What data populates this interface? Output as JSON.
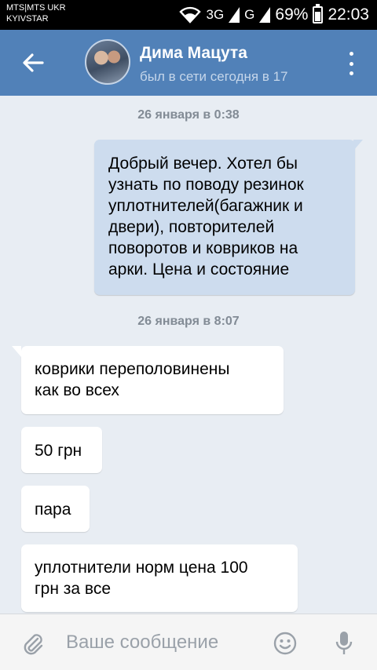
{
  "status_bar": {
    "carrier_line1": "MTS|MTS UKR",
    "carrier_line2": "KYIVSTAR",
    "network1": "3G",
    "network2": "G",
    "battery": "69%",
    "time": "22:03"
  },
  "header": {
    "name": "Дима Мацута",
    "status": "был в сети сегодня в 17"
  },
  "messages": [
    {
      "type": "date",
      "text": "26 января в 0:38"
    },
    {
      "type": "outgoing",
      "lines": [
        "Добрый вечер. Хотел бы",
        "узнать по поводу резинок",
        "уплотнителей(багажник и",
        "двери), повторителей",
        "поворотов и ковриков на",
        "арки. Цена и состояние"
      ]
    },
    {
      "type": "date",
      "text": "26 января в 8:07"
    },
    {
      "type": "incoming",
      "lines": [
        "коврики переполовинены",
        "как во всех"
      ]
    },
    {
      "type": "incoming",
      "lines": [
        "50 грн"
      ]
    },
    {
      "type": "incoming",
      "lines": [
        "пара"
      ]
    },
    {
      "type": "incoming",
      "lines": [
        "уплотнители норм цена 100",
        "грн за все"
      ]
    }
  ],
  "composer": {
    "placeholder": "Ваше сообщение"
  },
  "icons": {
    "back": "arrow-left-icon",
    "menu": "more-vertical-icon",
    "attach": "paperclip-icon",
    "emoji": "smiley-icon",
    "mic": "microphone-icon"
  },
  "colors": {
    "header": "#5181b8",
    "outgoing_bubble": "#cddcee",
    "incoming_bubble": "#ffffff",
    "background": "#e8edf3"
  }
}
